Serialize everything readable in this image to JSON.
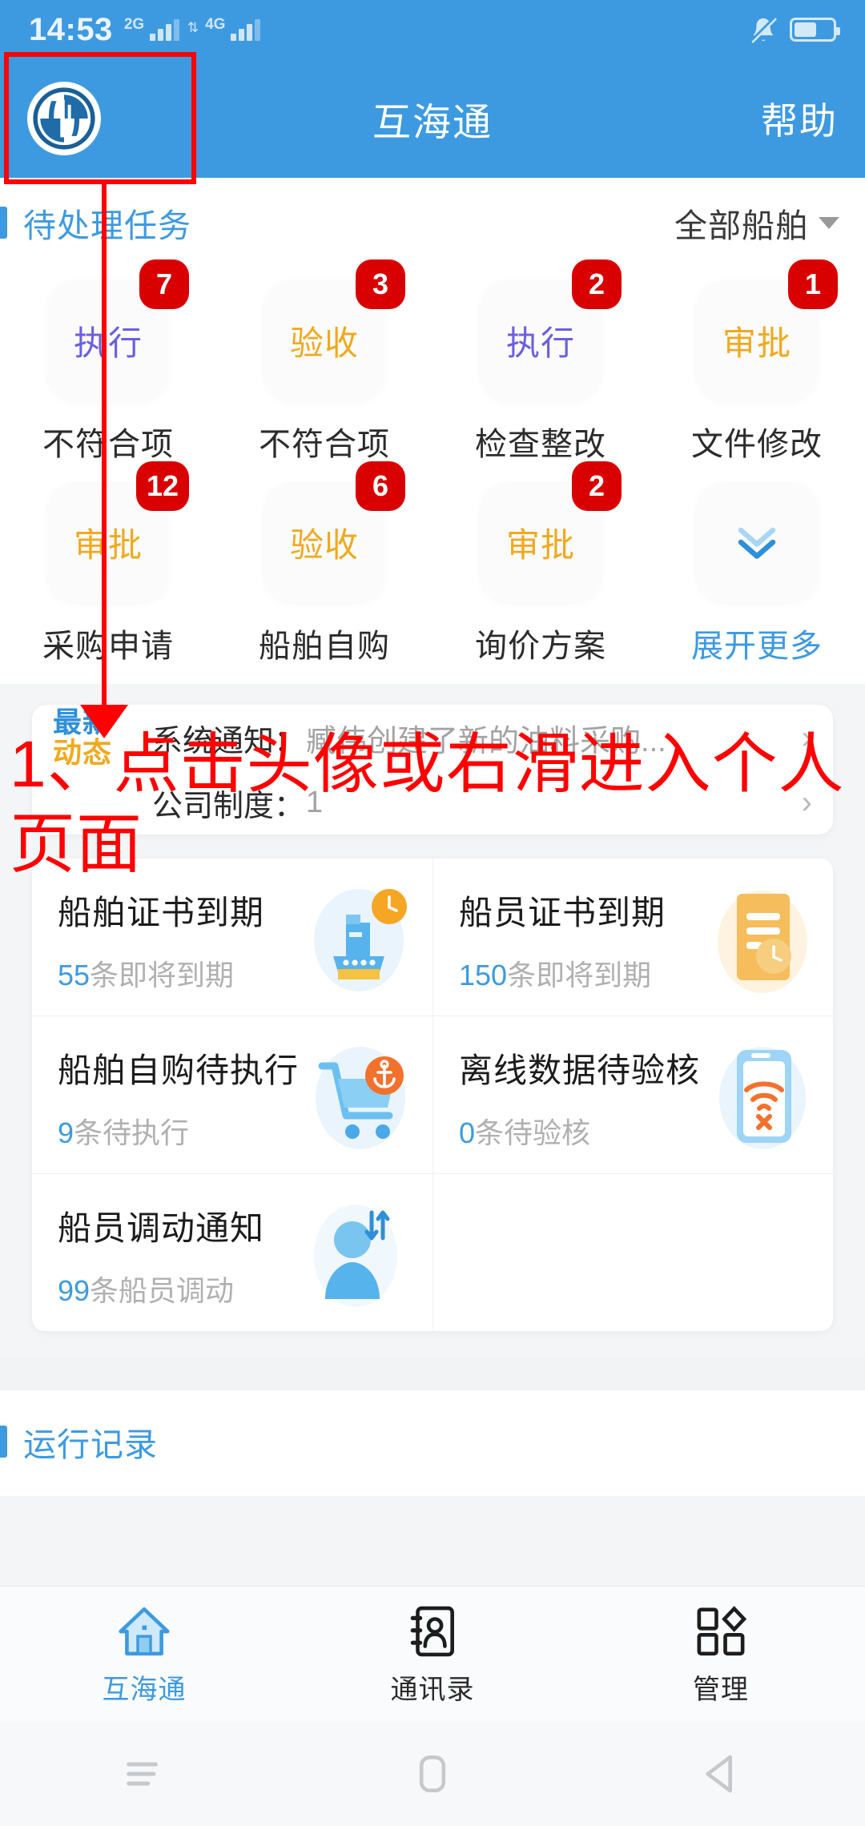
{
  "status_bar": {
    "time": "14:53",
    "network_labels": [
      "2G",
      "4G"
    ],
    "icons": [
      "mute-bell-icon",
      "battery-icon"
    ]
  },
  "app_bar": {
    "logo_alt": "app-logo",
    "title": "互海通",
    "help_label": "帮助"
  },
  "pending_tasks": {
    "section_title": "待处理任务",
    "ship_filter_label": "全部船舶",
    "tiles": [
      {
        "action": "执行",
        "badge": "7",
        "name": "不符合项",
        "color": "exec"
      },
      {
        "action": "验收",
        "badge": "3",
        "name": "不符合项",
        "color": "accept"
      },
      {
        "action": "执行",
        "badge": "2",
        "name": "检查整改",
        "color": "exec"
      },
      {
        "action": "审批",
        "badge": "1",
        "name": "文件修改",
        "color": "approve"
      },
      {
        "action": "审批",
        "badge": "12",
        "name": "采购申请",
        "color": "approve"
      },
      {
        "action": "验收",
        "badge": "6",
        "name": "船舶自购",
        "color": "accept"
      },
      {
        "action": "审批",
        "badge": "2",
        "name": "询价方案",
        "color": "approve"
      },
      {
        "action": "",
        "badge": "",
        "name": "展开更多",
        "color": "more"
      }
    ]
  },
  "news": {
    "tag_line1": "最新",
    "tag_line2": "动态",
    "rows": [
      {
        "label": "系统通知：",
        "text": "臧伟创建了新的油料采购..."
      },
      {
        "label": "公司制度：",
        "text": "1"
      }
    ]
  },
  "info_cards": [
    {
      "title": "船舶证书到期",
      "count": "55",
      "suffix": "条即将到期",
      "icon": "ship-certificate-icon"
    },
    {
      "title": "船员证书到期",
      "count": "150",
      "suffix": "条即将到期",
      "icon": "crew-certificate-icon"
    },
    {
      "title": "船舶自购待执行",
      "count": "9",
      "suffix": "条待执行",
      "icon": "purchase-cart-icon"
    },
    {
      "title": "离线数据待验核",
      "count": "0",
      "suffix": "条待验核",
      "icon": "offline-data-icon"
    },
    {
      "title": "船员调动通知",
      "count": "99",
      "suffix": "条船员调动",
      "icon": "crew-transfer-icon"
    }
  ],
  "run_record": {
    "section_title": "运行记录"
  },
  "bottom_nav": [
    {
      "label": "互海通",
      "icon": "home-icon",
      "active": true
    },
    {
      "label": "通讯录",
      "icon": "contacts-icon",
      "active": false
    },
    {
      "label": "管理",
      "icon": "manage-icon",
      "active": false
    }
  ],
  "system_nav": [
    "menu-icon",
    "home-square-icon",
    "back-icon"
  ],
  "annotation": {
    "text": "1、点击头像或右滑进入个人页面",
    "color": "#ff0000"
  },
  "colors": {
    "brand_blue": "#3d9ae0",
    "badge_red": "#d80000",
    "exec_purple": "#6b5fe0",
    "accept_orange": "#f0a91e",
    "annotation_red": "#ff0000"
  }
}
